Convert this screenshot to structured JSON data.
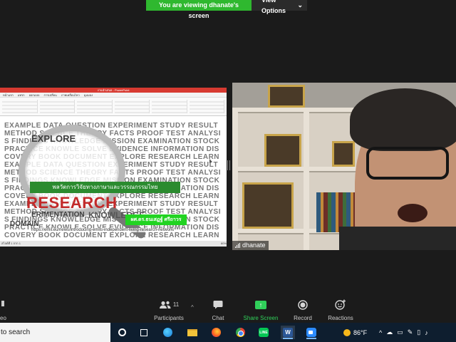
{
  "banner": {
    "text": "You are viewing dhanate's screen",
    "view_options": "View Options",
    "view_options_caret": "⌄"
  },
  "shared_screen": {
    "ppt_title": "งานนำเสนอ - PowerPoint",
    "ppt_tabs": [
      "หน้าแรก",
      "แทรก",
      "ออกแบบ",
      "การเปลี่ยน",
      "ภาพเคลื่อนไหว",
      "มุมมอง"
    ],
    "slide": {
      "research_word": "RESEARCH",
      "thai_title": "พลวัตการวิจัยทางภาษาและวรรณกรรมไทย",
      "thai_author": "ผศ.ดร.ธนเสฏฐ์ ศรีถาวร",
      "url": "https://emil.eu/news/introducing-emils-independent-living-research-network/",
      "cloud_words": [
        "EXAMPLE",
        "DATA",
        "QUESTION",
        "EXPERIMENT",
        "STUDY",
        "RESULT",
        "METHOD",
        "SCIENCE",
        "THEORY",
        "FACTS",
        "PROOF",
        "TEST",
        "ANALYSIS",
        "FINDINGS",
        "KNOWLEDGE",
        "MISSION",
        "EXAMINATION",
        "STOCK",
        "PRACTICE",
        "KNOWLE",
        "SOLVE",
        "EVIDENCE",
        "INFORMATION",
        "DISCOVERY",
        "BOOK",
        "DOCUMENT",
        "EXPLORE",
        "RESEARCH",
        "LEARN"
      ],
      "lens_lines": [
        "EXPLORE",
        "ERIMENTATION",
        "DOMAIN",
        "KNOWLEDGE"
      ]
    },
    "status": "สไลด์ที่ 1 จาก 1",
    "status_right": "80%"
  },
  "webcam": {
    "participant_name": "dhanate"
  },
  "toolbar": {
    "cut_label": "eo",
    "participants_label": "Participants",
    "participants_count": "11",
    "participants_caret": "^",
    "chat_label": "Chat",
    "share_label": "Share Screen",
    "record_label": "Record",
    "reactions_label": "Reactions",
    "colors": {
      "share_green": "#30d05a",
      "banner_green": "#2fb82f"
    }
  },
  "taskbar": {
    "search_text": "to search",
    "weather_temp": "86°F"
  }
}
